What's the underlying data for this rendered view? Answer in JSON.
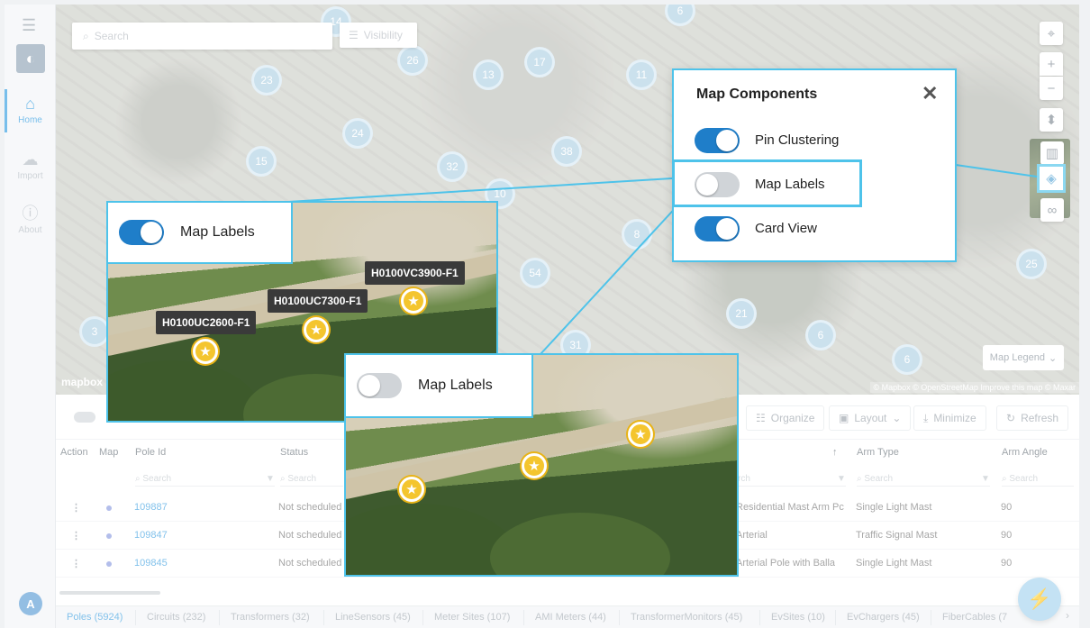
{
  "sidebar": {
    "menu_icon": "hamburger-icon",
    "logo_icon": "app-logo",
    "items": [
      {
        "label": "Home",
        "icon": "home-icon",
        "active": true
      },
      {
        "label": "Import",
        "icon": "cloud-upload-icon",
        "active": false
      },
      {
        "label": "About",
        "icon": "info-icon",
        "active": false
      }
    ],
    "avatar_initial": "A"
  },
  "map": {
    "search_placeholder": "Search",
    "visibility_label": "Visibility",
    "mapbox_logo": "mapbox",
    "attribution": "© Mapbox © OpenStreetMap Improve this map © Maxar",
    "legend_label": "Map Legend",
    "clusters": [
      "14",
      "6",
      "26",
      "23",
      "13",
      "17",
      "11",
      "24",
      "15",
      "32",
      "38",
      "10",
      "54",
      "3",
      "31",
      "21",
      "6",
      "6",
      "25",
      "8"
    ]
  },
  "popup": {
    "title": "Map Components",
    "close_icon": "close-icon",
    "toggles": [
      {
        "label": "Pin Clustering",
        "on": true
      },
      {
        "label": "Map Labels",
        "on": false
      },
      {
        "label": "Card View",
        "on": true
      }
    ]
  },
  "zoom_on": {
    "label": "Map Labels",
    "pins": [
      "H0100UC2600-F1",
      "H0100UC7300-F1",
      "H0100VC3900-F1"
    ]
  },
  "zoom_off": {
    "label": "Map Labels"
  },
  "toolbar": {
    "organize": "Organize",
    "layout": "Layout",
    "minimize": "Minimize",
    "refresh": "Refresh"
  },
  "table": {
    "headers": {
      "action": "Action",
      "map": "Map",
      "pole_id": "Pole Id",
      "status": "Status",
      "arm_type": "Arm Type",
      "arm_angle": "Arm Angle"
    },
    "filter_placeholder": "Search",
    "filter_placeholder_partial": "rch",
    "rows": [
      {
        "pole_id": "109887",
        "status": "Not scheduled",
        "type": "Residential Mast Arm Pc",
        "arm_type": "Single Light Mast",
        "arm_angle": "90"
      },
      {
        "pole_id": "109847",
        "status": "Not scheduled",
        "type": "Arterial",
        "arm_type": "Traffic Signal Mast",
        "arm_angle": "90"
      },
      {
        "pole_id": "109845",
        "status": "Not scheduled",
        "type": "Arterial Pole with Balla",
        "arm_type": "Single Light Mast",
        "arm_angle": "90"
      }
    ]
  },
  "tabs": [
    {
      "label": "Poles (5924)",
      "active": true
    },
    {
      "label": "Circuits (232)"
    },
    {
      "label": "Transformers (32)"
    },
    {
      "label": "LineSensors (45)"
    },
    {
      "label": "Meter Sites (107)"
    },
    {
      "label": "AMI Meters (44)"
    },
    {
      "label": "TransformerMonitors (45)"
    },
    {
      "label": "EvSites (10)"
    },
    {
      "label": "EvChargers (45)"
    },
    {
      "label": "FiberCables (7"
    }
  ],
  "colors": {
    "accent": "#4ec3ea",
    "toggle_on": "#1f7ec9",
    "link": "#3ea0e0",
    "pin": "#f4c52e"
  }
}
